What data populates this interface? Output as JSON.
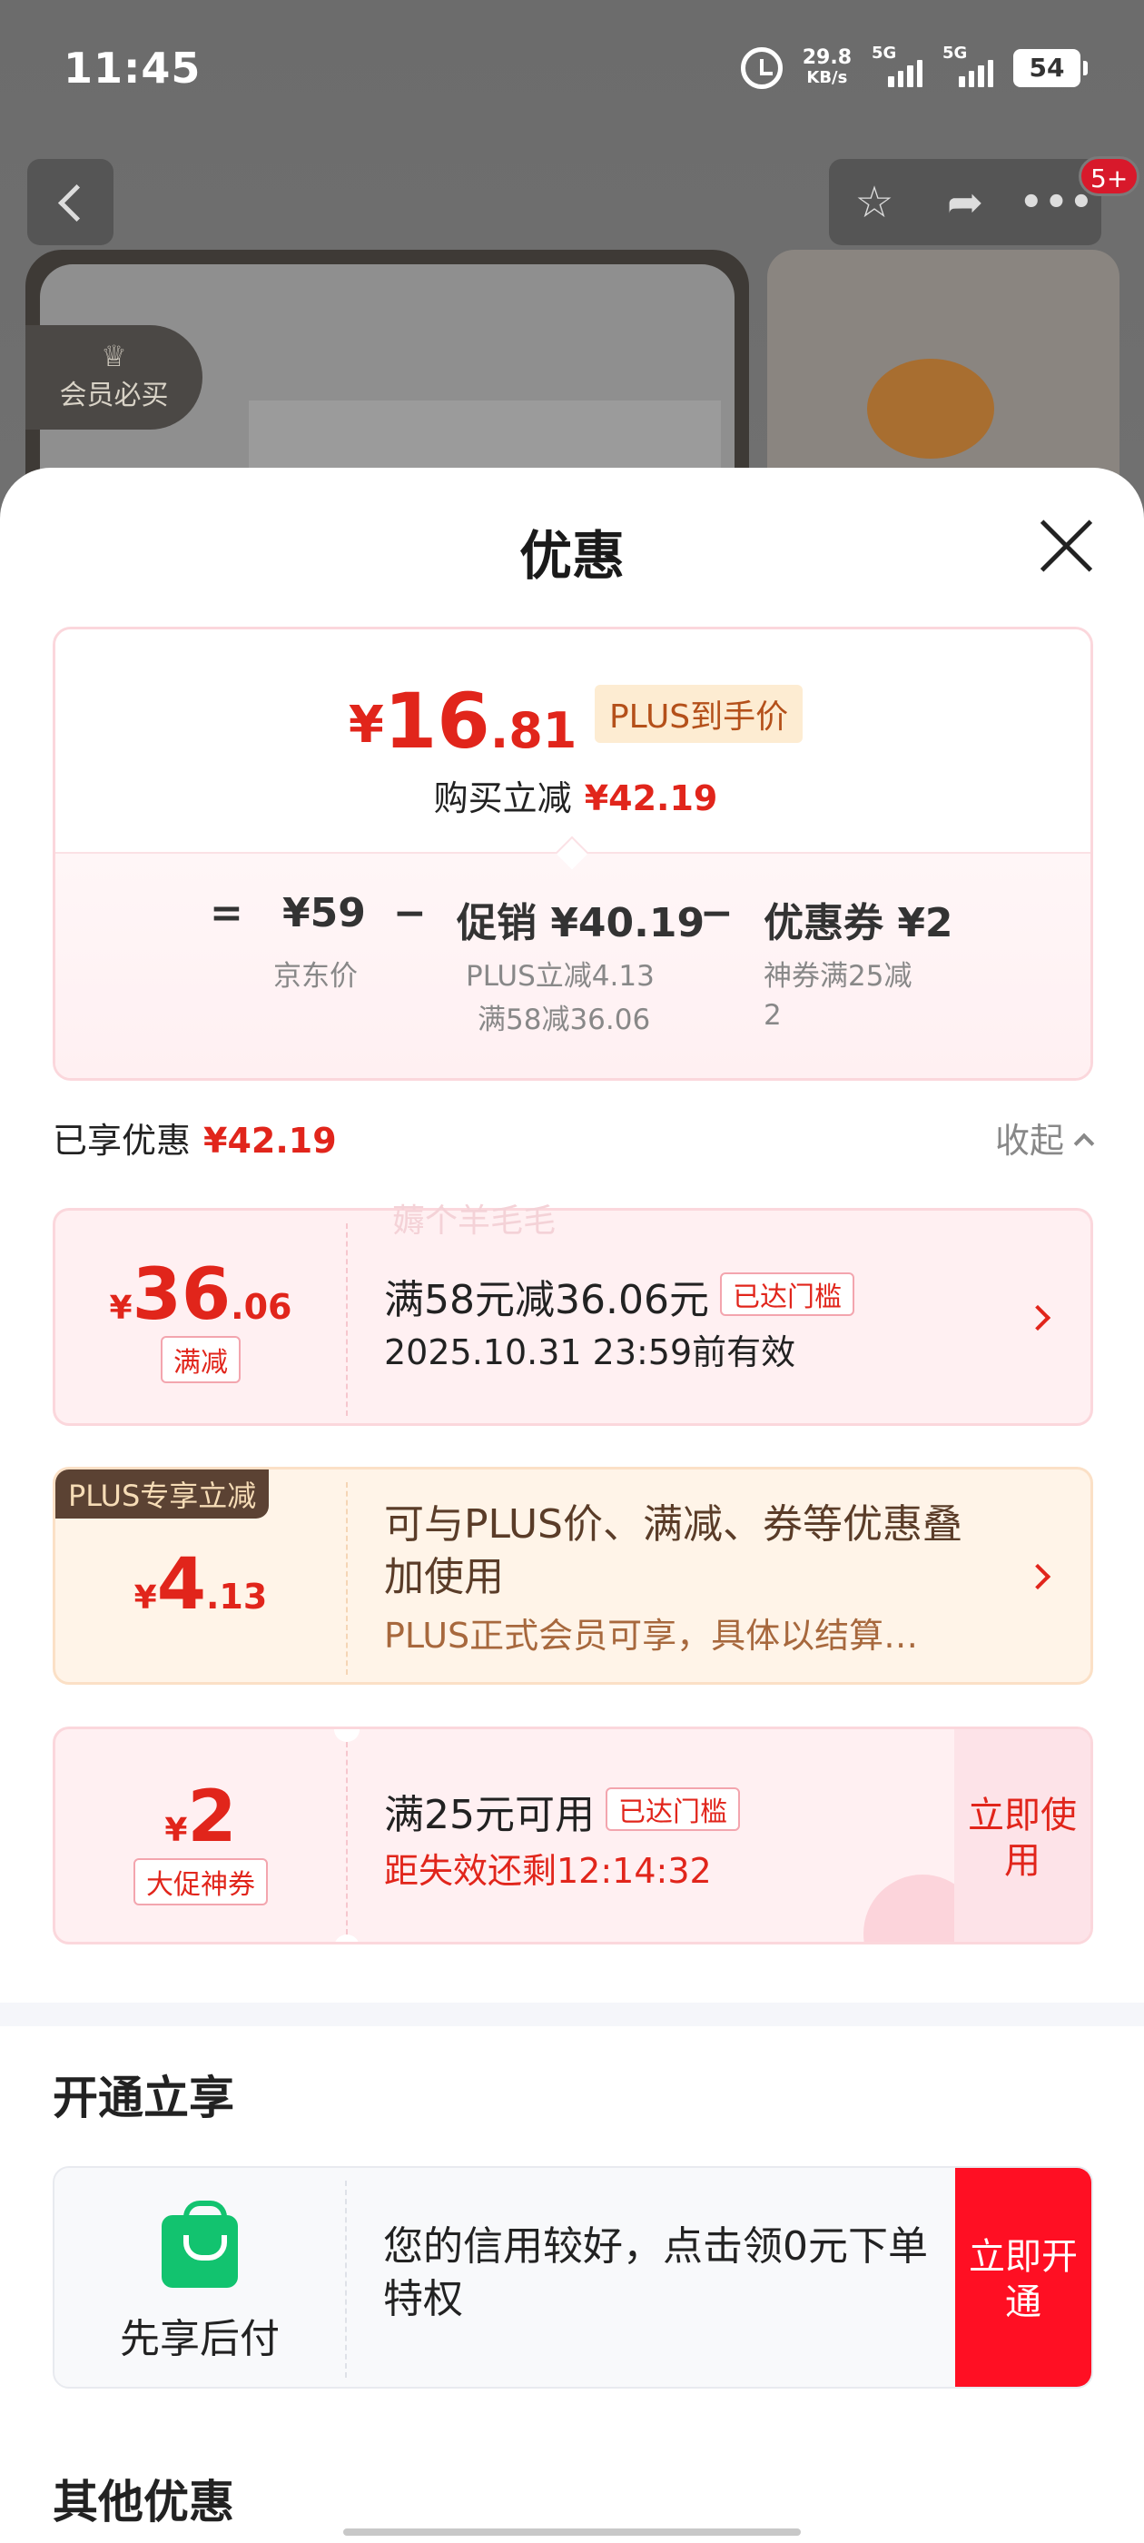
{
  "status_bar": {
    "time": "11:45",
    "net_speed": "29.8",
    "net_unit": "KB/s",
    "signal1": "5G",
    "signal2": "5G",
    "battery": "54"
  },
  "nav": {
    "badge": "5+",
    "vip_tag": "会员必买"
  },
  "sheet": {
    "title": "优惠"
  },
  "price_card": {
    "currency": "¥",
    "price_int": "16",
    "price_dec": ".81",
    "plus_tag": "PLUS到手价",
    "buy_reduce_label": "购买立减",
    "buy_reduce_value": "¥42.19",
    "eq": "=",
    "minus": "−",
    "jd_price": "¥59",
    "jd_price_label": "京东价",
    "promo": "促销 ¥40.19",
    "promo_sub1": "PLUS立减4.13",
    "promo_sub2": "满58减36.06",
    "coupon": "优惠券 ¥2",
    "coupon_sub1": "神券满25减",
    "coupon_sub2": "2"
  },
  "enjoyed": {
    "label": "已享优惠",
    "value": "¥42.19",
    "collapse": "收起"
  },
  "watermark": "薅个羊毛毛",
  "coupons": [
    {
      "currency": "¥",
      "int": "36",
      "dec": ".06",
      "kind": "满减",
      "title": "满58元减36.06元",
      "reach": "已达门槛",
      "sub": "2025.10.31 23:59前有效"
    },
    {
      "ribbon": "PLUS专享立减",
      "currency": "¥",
      "int": "4",
      "dec": ".13",
      "title": "可与PLUS价、满减、券等优惠叠加使用",
      "sub": "PLUS正式会员可享，具体以结算…"
    },
    {
      "currency": "¥",
      "int": "2",
      "kind": "大促神券",
      "title": "满25元可用",
      "reach": "已达门槛",
      "sub": "距失效还剩12:14:32",
      "action": "立即使用"
    }
  ],
  "open_section": {
    "title": "开通立享",
    "label": "先享后付",
    "text": "您的信用较好，点击领0元下单特权",
    "action": "立即开通"
  },
  "other_section": {
    "title": "其他优惠"
  }
}
